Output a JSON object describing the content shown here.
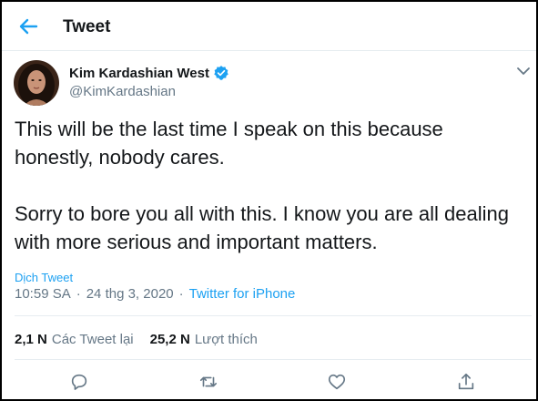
{
  "header": {
    "title": "Tweet"
  },
  "user": {
    "name": "Kim Kardashian West",
    "handle": "@KimKardashian",
    "verified": true
  },
  "tweet": {
    "text": "This will be the last time I speak on this because honestly, nobody cares.\n\nSorry to bore you all with this. I know you are all dealing with more serious and important matters.",
    "translate_label": "Dịch Tweet",
    "time": "10:59 SA",
    "date": "24 thg 3, 2020",
    "separator": "·",
    "source": "Twitter for iPhone"
  },
  "stats": {
    "retweets_count": "2,1 N",
    "retweets_label": "Các Tweet lại",
    "likes_count": "25,2 N",
    "likes_label": "Lượt thích"
  },
  "colors": {
    "accent": "#1da1f2",
    "secondary_text": "#657786",
    "primary_text": "#14171a",
    "divider": "#e6ecf0"
  },
  "icons": {
    "back": "arrow-left-icon",
    "verified": "verified-badge-icon",
    "more": "chevron-down-icon",
    "reply": "reply-icon",
    "retweet": "retweet-icon",
    "like": "heart-icon",
    "share": "share-icon"
  }
}
